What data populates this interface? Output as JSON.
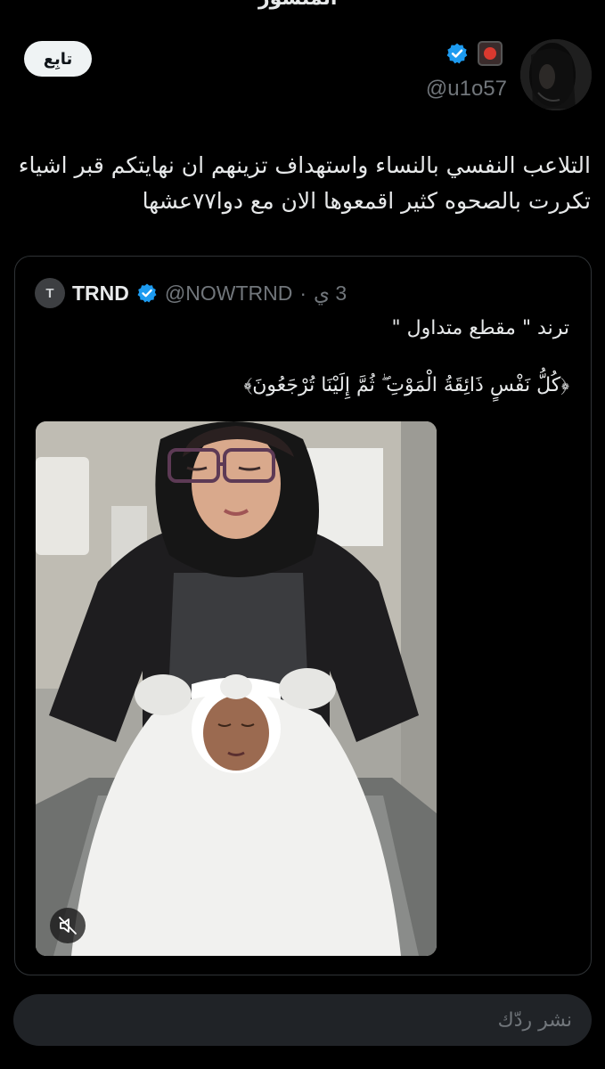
{
  "header": {
    "title": "المنشور"
  },
  "tweet": {
    "follow_label": "تابِع",
    "handle": "@u1o57",
    "text": "التلاعب النفسي بالنساء واستهداف تزينهم ان نهايتكم قبر اشياء تكررت بالصحوه كثير اقمعوها الان مع دوا٧٧عشها",
    "verified_color": "#1d9bf0"
  },
  "quote": {
    "logo_letter": "T",
    "name": "TRND",
    "handle": "@NOWTRND",
    "separator": "·",
    "time": "3 ي",
    "line1": "ترند \" مقطع متداول \"",
    "line2": "﴿كُلُّ نَفْسٍ ذَائِقَةُ الْمَوْتِ ۖ ثُمَّ إِلَيْنَا تُرْجَعُونَ﴾"
  },
  "reply": {
    "placeholder": "نشر ردّك"
  }
}
